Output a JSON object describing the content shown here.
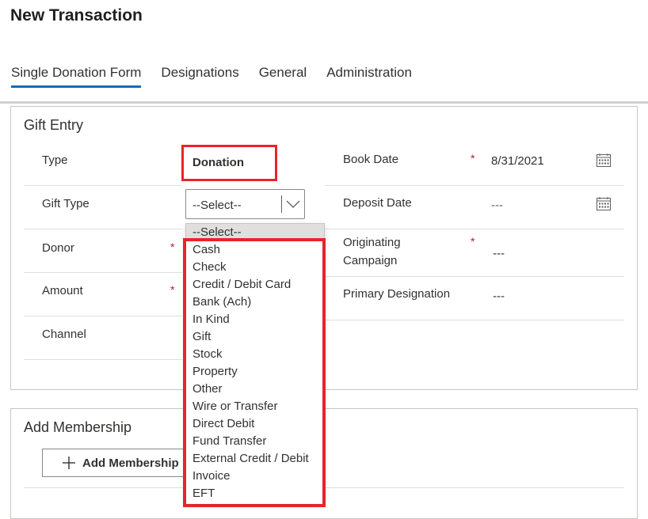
{
  "page": {
    "title": "New Transaction"
  },
  "tabs": [
    {
      "label": "Single Donation Form",
      "active": true
    },
    {
      "label": "Designations",
      "active": false
    },
    {
      "label": "General",
      "active": false
    },
    {
      "label": "Administration",
      "active": false
    }
  ],
  "gift_entry": {
    "title": "Gift Entry",
    "type": {
      "label": "Type",
      "value": "Donation"
    },
    "gift_type": {
      "label": "Gift Type",
      "selected": "--Select--"
    },
    "donor": {
      "label": "Donor",
      "required_mark": "*"
    },
    "amount": {
      "label": "Amount",
      "required_mark": "*"
    },
    "channel": {
      "label": "Channel"
    },
    "book_date": {
      "label": "Book Date",
      "required_mark": "*",
      "value": "8/31/2021",
      "icon": "calendar-icon"
    },
    "deposit_date": {
      "label": "Deposit Date",
      "value": "---",
      "icon": "calendar-icon"
    },
    "originating_campaign": {
      "label_line1": "Originating",
      "label_line2": "Campaign",
      "required_mark": "*",
      "value": "---"
    },
    "primary_designation": {
      "label": "Primary Designation",
      "value": "---"
    }
  },
  "dropdown": {
    "header": "--Select--",
    "options": [
      "Cash",
      "Check",
      "Credit / Debit Card",
      "Bank (Ach)",
      "In Kind",
      "Gift",
      "Stock",
      "Property",
      "Other",
      "Wire or Transfer",
      "Direct Debit",
      "Fund Transfer",
      "External Credit / Debit",
      "Invoice",
      "EFT"
    ],
    "highlight_color": "#e8242a"
  },
  "membership": {
    "title": "Add Membership",
    "button_label": "Add Membership",
    "button_icon": "plus-icon"
  },
  "colors": {
    "accent": "#0f6cbd",
    "required": "#a4262c",
    "highlight": "#e8242a"
  }
}
